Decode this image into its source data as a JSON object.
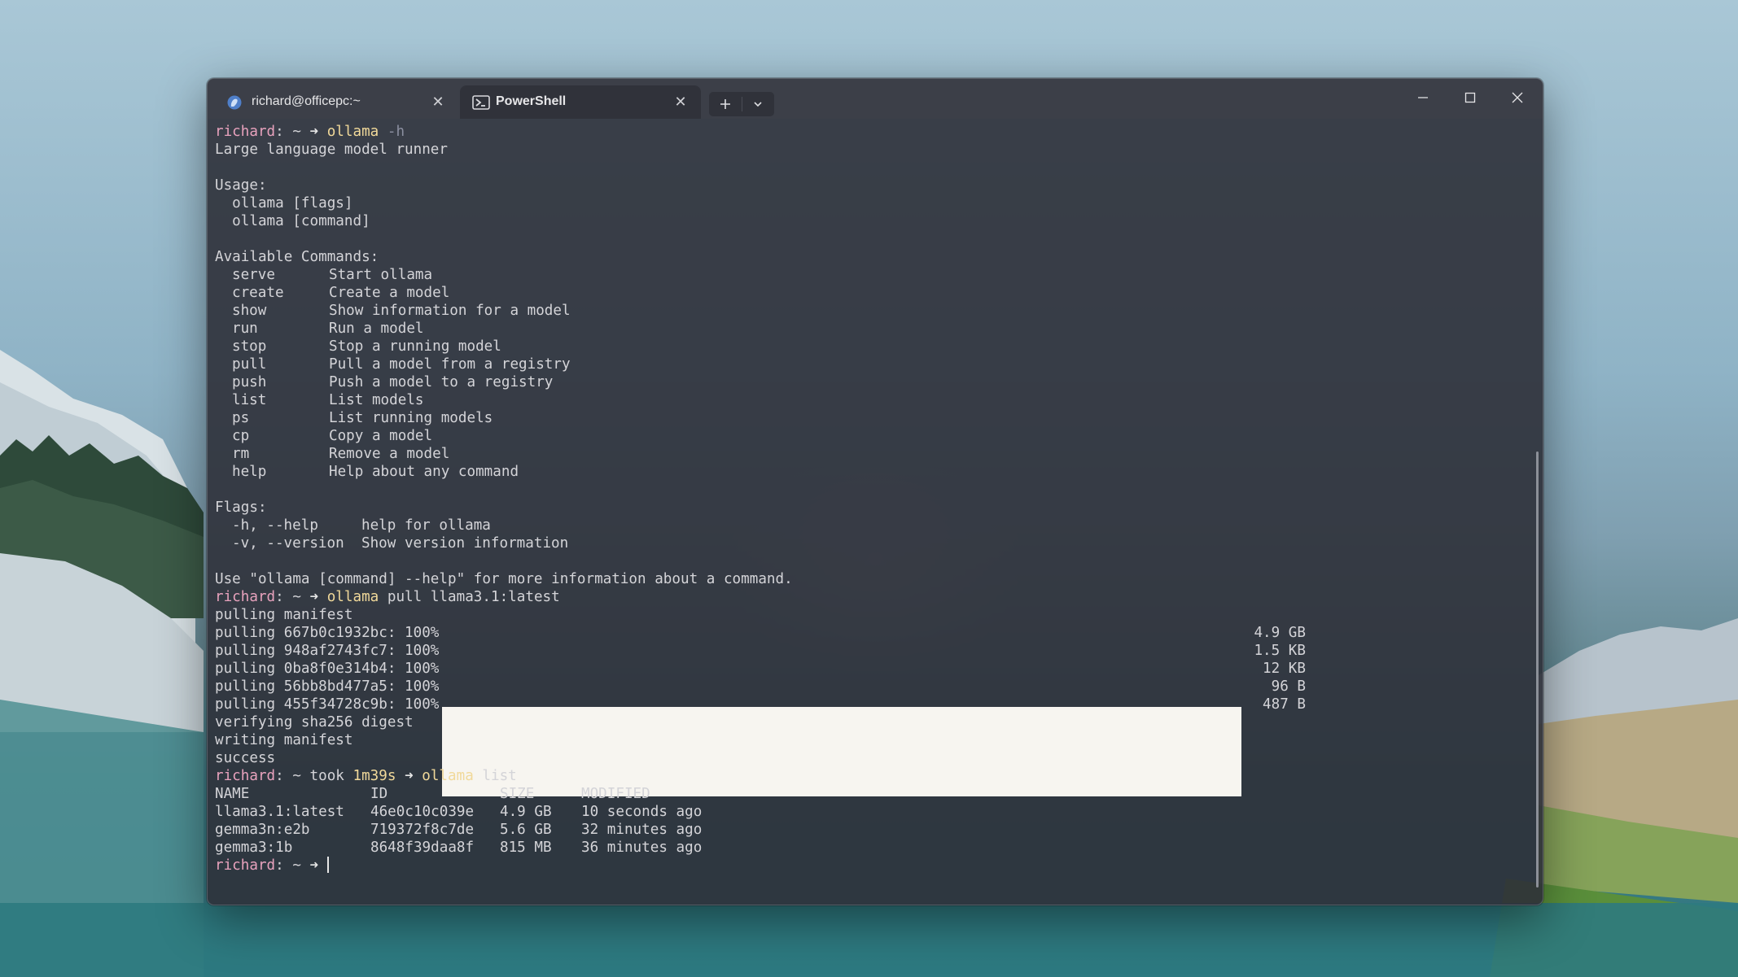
{
  "window": {
    "tabs": [
      {
        "label": "richard@officepc:~",
        "icon": "linux-penguin-icon",
        "active": false
      },
      {
        "label": "PowerShell",
        "icon": "powershell-icon",
        "active": true
      }
    ],
    "new_tab_label": "+",
    "controls": [
      "minimize",
      "maximize",
      "close"
    ]
  },
  "terminal": {
    "prompt_user": "richard",
    "prompt_sep": ": ~ ",
    "arrow": "➜",
    "cmd1": {
      "program": "ollama",
      "args": " -h"
    },
    "help_text": {
      "description": "Large language model runner",
      "usage_header": "Usage:",
      "usage_lines": [
        "  ollama [flags]",
        "  ollama [command]"
      ],
      "commands_header": "Available Commands:",
      "commands": [
        {
          "name": "serve",
          "desc": "Start ollama"
        },
        {
          "name": "create",
          "desc": "Create a model"
        },
        {
          "name": "show",
          "desc": "Show information for a model"
        },
        {
          "name": "run",
          "desc": "Run a model"
        },
        {
          "name": "stop",
          "desc": "Stop a running model"
        },
        {
          "name": "pull",
          "desc": "Pull a model from a registry"
        },
        {
          "name": "push",
          "desc": "Push a model to a registry"
        },
        {
          "name": "list",
          "desc": "List models"
        },
        {
          "name": "ps",
          "desc": "List running models"
        },
        {
          "name": "cp",
          "desc": "Copy a model"
        },
        {
          "name": "rm",
          "desc": "Remove a model"
        },
        {
          "name": "help",
          "desc": "Help about any command"
        }
      ],
      "flags_header": "Flags:",
      "flags": [
        {
          "name": "-h, --help",
          "desc": "help for ollama"
        },
        {
          "name": "-v, --version",
          "desc": "Show version information"
        }
      ],
      "footer": "Use \"ollama [command] --help\" for more information about a command."
    },
    "cmd2": {
      "program": "ollama",
      "args": " pull llama3.1:latest"
    },
    "pull_output": {
      "manifest": "pulling manifest",
      "layers": [
        {
          "label": "pulling 667b0c1932bc: 100%",
          "size": "4.9 GB"
        },
        {
          "label": "pulling 948af2743fc7: 100%",
          "size": "1.5 KB"
        },
        {
          "label": "pulling 0ba8f0e314b4: 100%",
          "size": "12 KB"
        },
        {
          "label": "pulling 56bb8bd477a5: 100%",
          "size": "96 B"
        },
        {
          "label": "pulling 455f34728c9b: 100%",
          "size": "487 B"
        }
      ],
      "verify": "verifying sha256 digest",
      "writing": "writing manifest",
      "success": "success"
    },
    "took_prefix": "took ",
    "took_time": "1m39s",
    "cmd3": {
      "program": "ollama",
      "args": " list"
    },
    "list_table": {
      "headers": [
        "NAME",
        "ID",
        "SIZE",
        "MODIFIED"
      ],
      "rows": [
        [
          "llama3.1:latest",
          "46e0c10c039e",
          "4.9 GB",
          "10 seconds ago"
        ],
        [
          "gemma3n:e2b",
          "719372f8c7de",
          "5.6 GB",
          "32 minutes ago"
        ],
        [
          "gemma3:1b",
          "8648f39daa8f",
          "815 MB",
          "36 minutes ago"
        ]
      ]
    }
  },
  "colors": {
    "user": "#e8a2bd",
    "command": "#f1d99a",
    "text": "#d4d4d8",
    "background": "#2e3038"
  }
}
